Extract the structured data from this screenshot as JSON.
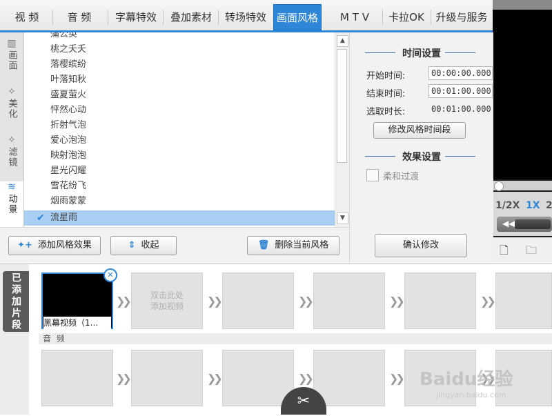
{
  "tabs": [
    {
      "label": "视 频"
    },
    {
      "label": "音 频"
    },
    {
      "label": "字幕特效"
    },
    {
      "label": "叠加素材"
    },
    {
      "label": "转场特效"
    },
    {
      "label": "画面风格",
      "active": true
    },
    {
      "label": "M T V"
    },
    {
      "label": "卡拉OK"
    },
    {
      "label": "升级与服务"
    }
  ],
  "side_tabs": [
    {
      "label": "画面",
      "icon": "film-icon"
    },
    {
      "label": "美化",
      "icon": "wand-icon"
    },
    {
      "label": "滤镜",
      "icon": "wand-icon"
    },
    {
      "label": "动景",
      "icon": "waves-icon",
      "active": true
    }
  ],
  "style_list": {
    "items": [
      "蒲公英",
      "桃之夭夭",
      "落樱缤纷",
      "叶落知秋",
      "盛夏萤火",
      "怦然心动",
      "折射气泡",
      "爱心泡泡",
      "映射泡泡",
      "星光闪耀",
      "雪花纷飞",
      "烟雨蒙蒙",
      "流星雨"
    ],
    "selected": "流星雨"
  },
  "settings": {
    "time_title": "时间设置",
    "start_label": "开始时间:",
    "start_value": "00:00:00.000",
    "end_label": "结束时间:",
    "end_value": "00:01:00.000",
    "duration_label": "选取时长:",
    "duration_value": "00:01:00.000",
    "modify_time_button": "修改风格时间段",
    "effect_title": "效果设置",
    "soft_transition_label": "柔和过渡",
    "soft_transition_checked": false,
    "confirm_button": "确认修改"
  },
  "actions": {
    "add_effect": "添加风格效果",
    "collapse": "收起",
    "delete_current": "删除当前风格"
  },
  "preview": {
    "speeds": [
      "1/2X",
      "1X",
      "2"
    ],
    "active_speed": "1X"
  },
  "timeline": {
    "added_tab": "已添加片段",
    "first_clip_name": "黑幕视频（1...",
    "empty_hint": "双击此处\n添加视频",
    "audio_label": "音 频"
  },
  "watermark": {
    "main": "Baidu经验",
    "sub": "jingyan.baidu.com"
  },
  "colors": {
    "accent": "#2f86d6",
    "selection": "#a9cff5",
    "dark_panel": "#1d1d1d"
  }
}
